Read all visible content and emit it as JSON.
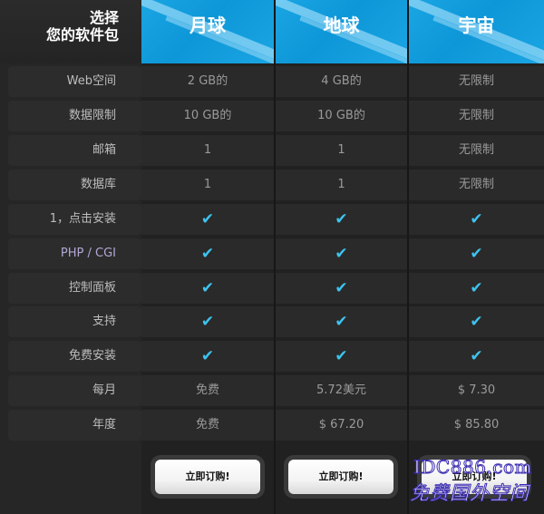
{
  "header": {
    "title_line1": "选择",
    "title_line2": "您的软件包"
  },
  "plans": [
    {
      "name": "月球"
    },
    {
      "name": "地球"
    },
    {
      "name": "宇宙"
    }
  ],
  "rows": [
    {
      "label": "Web空间",
      "values": [
        "2 GB的",
        "4 GB的",
        "无限制"
      ]
    },
    {
      "label": "数据限制",
      "values": [
        "10 GB的",
        "10 GB的",
        "无限制"
      ]
    },
    {
      "label": "邮箱",
      "values": [
        "1",
        "1",
        "无限制"
      ]
    },
    {
      "label": "数据库",
      "values": [
        "1",
        "1",
        "无限制"
      ]
    },
    {
      "label": "1，点击安装",
      "values": [
        "✔",
        "✔",
        "✔"
      ]
    },
    {
      "label": "PHP / CGI",
      "values": [
        "✔",
        "✔",
        "✔"
      ]
    },
    {
      "label": "控制面板",
      "values": [
        "✔",
        "✔",
        "✔"
      ]
    },
    {
      "label": "支持",
      "values": [
        "✔",
        "✔",
        "✔"
      ]
    },
    {
      "label": "免费安装",
      "values": [
        "✔",
        "✔",
        "✔"
      ]
    },
    {
      "label": "每月",
      "values": [
        "免费",
        "5.72美元",
        "$ 7.30"
      ]
    },
    {
      "label": "年度",
      "values": [
        "免费",
        "$ 67.20",
        "$ 85.80"
      ]
    }
  ],
  "buttons": {
    "subscribe_label": "立即订购!"
  },
  "watermark": {
    "line1": "IDC886.com",
    "line2": "免费国外空间"
  },
  "colors": {
    "header_blue": "#1aa5e3",
    "check_blue": "#3ec3ef",
    "background": "#262626"
  }
}
